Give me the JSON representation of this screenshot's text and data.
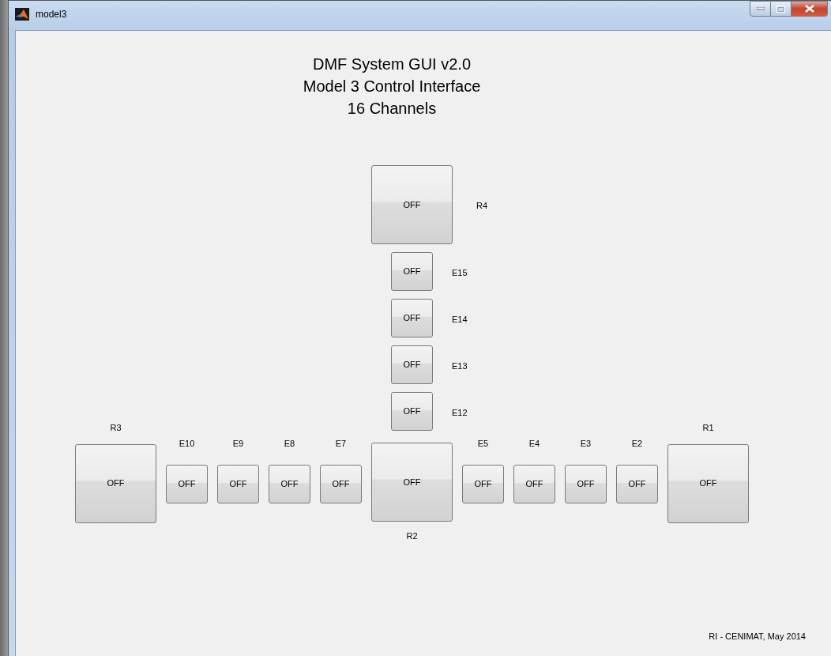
{
  "window": {
    "title": "model3"
  },
  "heading": [
    "DMF System GUI v2.0",
    "Model 3 Control Interface",
    "16 Channels"
  ],
  "vertical_arm": [
    {
      "name": "R4",
      "kind": "reservoir",
      "button": "OFF"
    },
    {
      "name": "E15",
      "kind": "electrode",
      "button": "OFF"
    },
    {
      "name": "E14",
      "kind": "electrode",
      "button": "OFF"
    },
    {
      "name": "E13",
      "kind": "electrode",
      "button": "OFF"
    },
    {
      "name": "E12",
      "kind": "electrode",
      "button": "OFF"
    }
  ],
  "left_arm": [
    {
      "name": "R3",
      "kind": "reservoir",
      "button": "OFF"
    },
    {
      "name": "E10",
      "kind": "electrode",
      "button": "OFF"
    },
    {
      "name": "E9",
      "kind": "electrode",
      "button": "OFF"
    },
    {
      "name": "E8",
      "kind": "electrode",
      "button": "OFF"
    },
    {
      "name": "E7",
      "kind": "electrode",
      "button": "OFF"
    }
  ],
  "junction": {
    "name": "R2",
    "kind": "reservoir",
    "button": "OFF"
  },
  "right_arm": [
    {
      "name": "E5",
      "kind": "electrode",
      "button": "OFF"
    },
    {
      "name": "E4",
      "kind": "electrode",
      "button": "OFF"
    },
    {
      "name": "E3",
      "kind": "electrode",
      "button": "OFF"
    },
    {
      "name": "E2",
      "kind": "electrode",
      "button": "OFF"
    },
    {
      "name": "R1",
      "kind": "reservoir",
      "button": "OFF"
    }
  ],
  "footer": "RI - CENIMAT, May 2014"
}
